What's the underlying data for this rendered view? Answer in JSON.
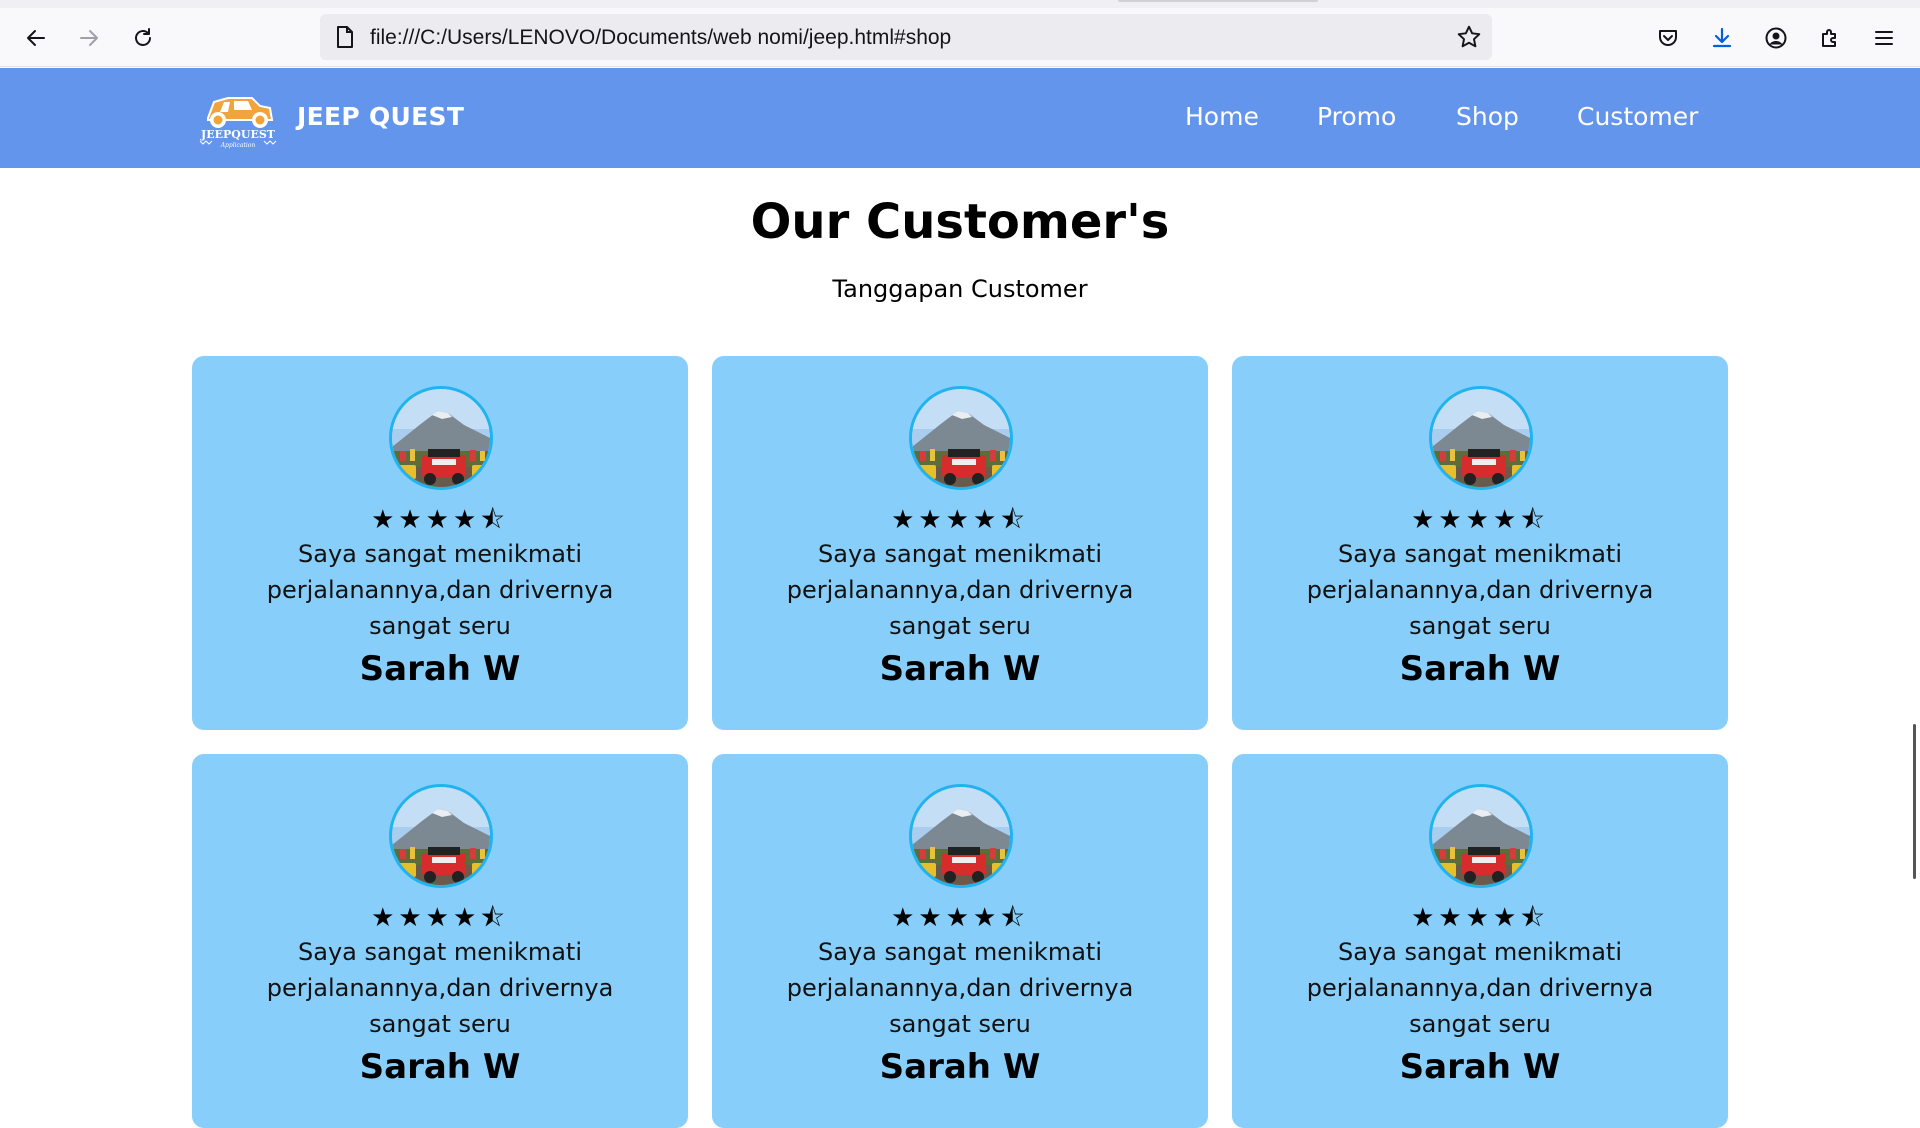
{
  "browser": {
    "url": "file:///C:/Users/LENOVO/Documents/web nomi/jeep.html#shop"
  },
  "site": {
    "brand": "JEEP QUEST",
    "logo_text": "JEEPQUEST",
    "logo_subtext": "Application",
    "nav": [
      "Home",
      "Promo",
      "Shop",
      "Customer"
    ]
  },
  "section": {
    "title": "Our Customer's",
    "subtitle": "Tanggapan Customer"
  },
  "cards": [
    {
      "stars": "★★★★⯪",
      "rating": 4.5,
      "review": "Saya sangat menikmati perjalanannya,dan drivernya sangat seru",
      "name": "Sarah W"
    },
    {
      "stars": "★★★★⯪",
      "rating": 4.5,
      "review": "Saya sangat menikmati perjalanannya,dan drivernya sangat seru",
      "name": "Sarah W"
    },
    {
      "stars": "★★★★⯪",
      "rating": 4.5,
      "review": "Saya sangat menikmati perjalanannya,dan drivernya sangat seru",
      "name": "Sarah W"
    },
    {
      "stars": "★★★★⯪",
      "rating": 4.5,
      "review": "Saya sangat menikmati perjalanannya,dan drivernya sangat seru",
      "name": "Sarah W"
    },
    {
      "stars": "★★★★⯪",
      "rating": 4.5,
      "review": "Saya sangat menikmati perjalanannya,dan drivernya sangat seru",
      "name": "Sarah W"
    },
    {
      "stars": "★★★★⯪",
      "rating": 4.5,
      "review": "Saya sangat menikmati perjalanannya,dan drivernya sangat seru",
      "name": "Sarah W"
    }
  ],
  "colors": {
    "nav_bg": "#6495ed",
    "card_bg": "#87cefa",
    "avatar_border": "#1fb3f0",
    "download_icon": "#0060df"
  },
  "icons": [
    "back-icon",
    "forward-icon",
    "reload-icon",
    "page-icon",
    "bookmark-star-icon",
    "pocket-icon",
    "download-icon",
    "account-icon",
    "extensions-icon",
    "menu-icon"
  ]
}
